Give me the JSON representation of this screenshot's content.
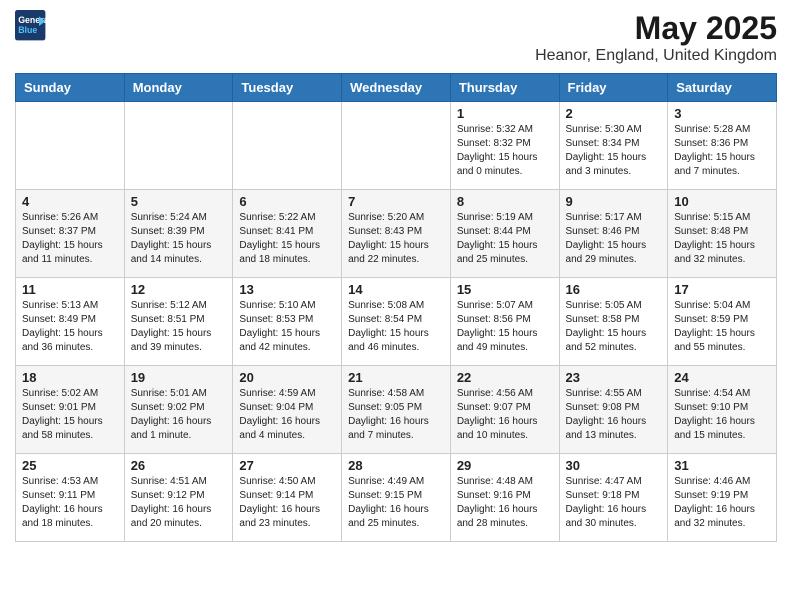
{
  "header": {
    "logo_line1": "General",
    "logo_line2": "Blue",
    "month_title": "May 2025",
    "location": "Heanor, England, United Kingdom"
  },
  "days_of_week": [
    "Sunday",
    "Monday",
    "Tuesday",
    "Wednesday",
    "Thursday",
    "Friday",
    "Saturday"
  ],
  "weeks": [
    [
      {
        "num": "",
        "info": ""
      },
      {
        "num": "",
        "info": ""
      },
      {
        "num": "",
        "info": ""
      },
      {
        "num": "",
        "info": ""
      },
      {
        "num": "1",
        "info": "Sunrise: 5:32 AM\nSunset: 8:32 PM\nDaylight: 15 hours\nand 0 minutes."
      },
      {
        "num": "2",
        "info": "Sunrise: 5:30 AM\nSunset: 8:34 PM\nDaylight: 15 hours\nand 3 minutes."
      },
      {
        "num": "3",
        "info": "Sunrise: 5:28 AM\nSunset: 8:36 PM\nDaylight: 15 hours\nand 7 minutes."
      }
    ],
    [
      {
        "num": "4",
        "info": "Sunrise: 5:26 AM\nSunset: 8:37 PM\nDaylight: 15 hours\nand 11 minutes."
      },
      {
        "num": "5",
        "info": "Sunrise: 5:24 AM\nSunset: 8:39 PM\nDaylight: 15 hours\nand 14 minutes."
      },
      {
        "num": "6",
        "info": "Sunrise: 5:22 AM\nSunset: 8:41 PM\nDaylight: 15 hours\nand 18 minutes."
      },
      {
        "num": "7",
        "info": "Sunrise: 5:20 AM\nSunset: 8:43 PM\nDaylight: 15 hours\nand 22 minutes."
      },
      {
        "num": "8",
        "info": "Sunrise: 5:19 AM\nSunset: 8:44 PM\nDaylight: 15 hours\nand 25 minutes."
      },
      {
        "num": "9",
        "info": "Sunrise: 5:17 AM\nSunset: 8:46 PM\nDaylight: 15 hours\nand 29 minutes."
      },
      {
        "num": "10",
        "info": "Sunrise: 5:15 AM\nSunset: 8:48 PM\nDaylight: 15 hours\nand 32 minutes."
      }
    ],
    [
      {
        "num": "11",
        "info": "Sunrise: 5:13 AM\nSunset: 8:49 PM\nDaylight: 15 hours\nand 36 minutes."
      },
      {
        "num": "12",
        "info": "Sunrise: 5:12 AM\nSunset: 8:51 PM\nDaylight: 15 hours\nand 39 minutes."
      },
      {
        "num": "13",
        "info": "Sunrise: 5:10 AM\nSunset: 8:53 PM\nDaylight: 15 hours\nand 42 minutes."
      },
      {
        "num": "14",
        "info": "Sunrise: 5:08 AM\nSunset: 8:54 PM\nDaylight: 15 hours\nand 46 minutes."
      },
      {
        "num": "15",
        "info": "Sunrise: 5:07 AM\nSunset: 8:56 PM\nDaylight: 15 hours\nand 49 minutes."
      },
      {
        "num": "16",
        "info": "Sunrise: 5:05 AM\nSunset: 8:58 PM\nDaylight: 15 hours\nand 52 minutes."
      },
      {
        "num": "17",
        "info": "Sunrise: 5:04 AM\nSunset: 8:59 PM\nDaylight: 15 hours\nand 55 minutes."
      }
    ],
    [
      {
        "num": "18",
        "info": "Sunrise: 5:02 AM\nSunset: 9:01 PM\nDaylight: 15 hours\nand 58 minutes."
      },
      {
        "num": "19",
        "info": "Sunrise: 5:01 AM\nSunset: 9:02 PM\nDaylight: 16 hours\nand 1 minute."
      },
      {
        "num": "20",
        "info": "Sunrise: 4:59 AM\nSunset: 9:04 PM\nDaylight: 16 hours\nand 4 minutes."
      },
      {
        "num": "21",
        "info": "Sunrise: 4:58 AM\nSunset: 9:05 PM\nDaylight: 16 hours\nand 7 minutes."
      },
      {
        "num": "22",
        "info": "Sunrise: 4:56 AM\nSunset: 9:07 PM\nDaylight: 16 hours\nand 10 minutes."
      },
      {
        "num": "23",
        "info": "Sunrise: 4:55 AM\nSunset: 9:08 PM\nDaylight: 16 hours\nand 13 minutes."
      },
      {
        "num": "24",
        "info": "Sunrise: 4:54 AM\nSunset: 9:10 PM\nDaylight: 16 hours\nand 15 minutes."
      }
    ],
    [
      {
        "num": "25",
        "info": "Sunrise: 4:53 AM\nSunset: 9:11 PM\nDaylight: 16 hours\nand 18 minutes."
      },
      {
        "num": "26",
        "info": "Sunrise: 4:51 AM\nSunset: 9:12 PM\nDaylight: 16 hours\nand 20 minutes."
      },
      {
        "num": "27",
        "info": "Sunrise: 4:50 AM\nSunset: 9:14 PM\nDaylight: 16 hours\nand 23 minutes."
      },
      {
        "num": "28",
        "info": "Sunrise: 4:49 AM\nSunset: 9:15 PM\nDaylight: 16 hours\nand 25 minutes."
      },
      {
        "num": "29",
        "info": "Sunrise: 4:48 AM\nSunset: 9:16 PM\nDaylight: 16 hours\nand 28 minutes."
      },
      {
        "num": "30",
        "info": "Sunrise: 4:47 AM\nSunset: 9:18 PM\nDaylight: 16 hours\nand 30 minutes."
      },
      {
        "num": "31",
        "info": "Sunrise: 4:46 AM\nSunset: 9:19 PM\nDaylight: 16 hours\nand 32 minutes."
      }
    ]
  ]
}
